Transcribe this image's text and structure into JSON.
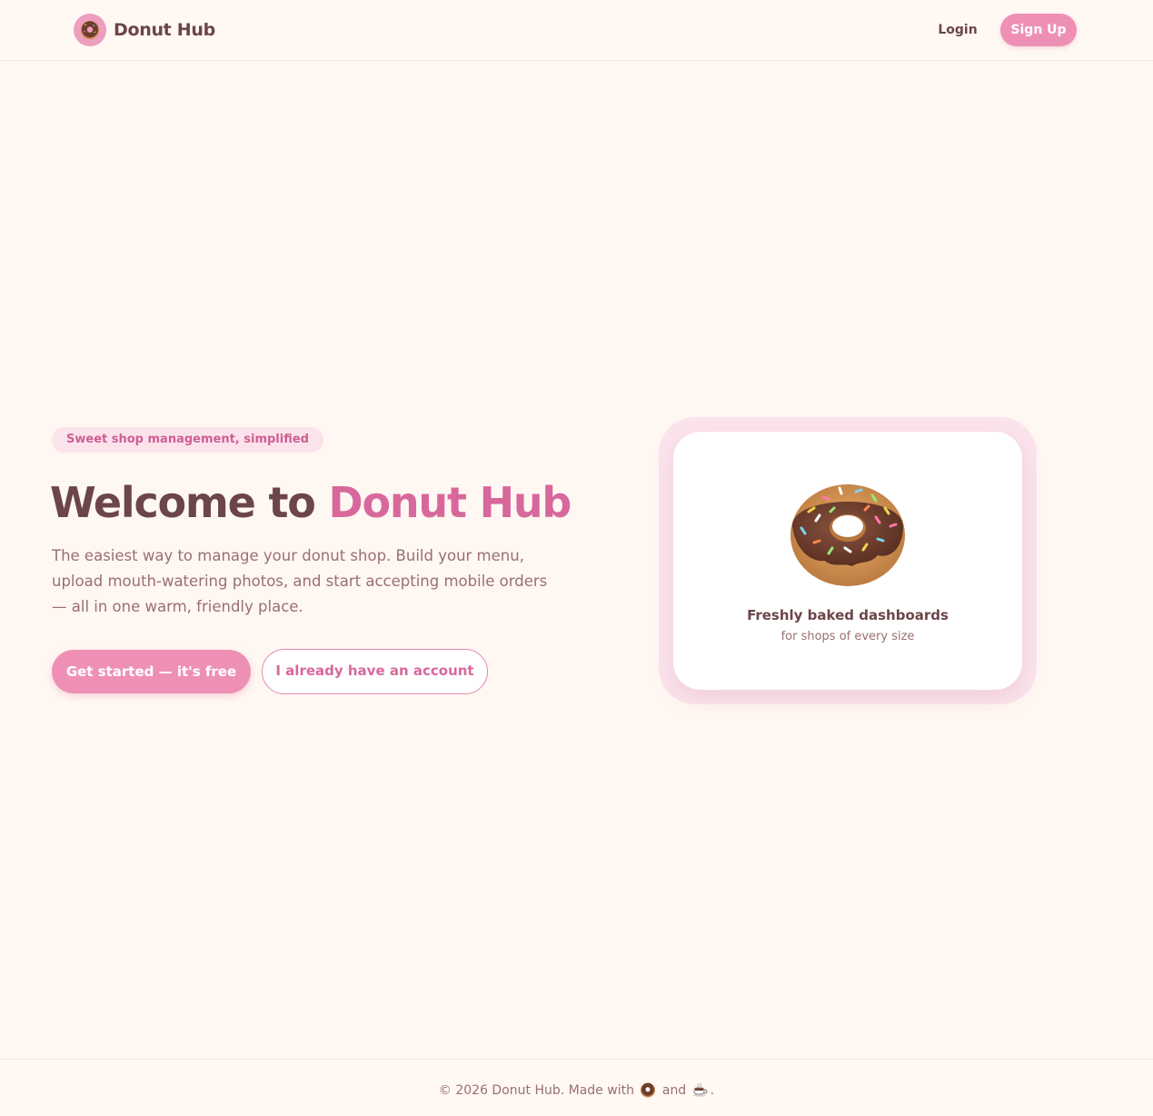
{
  "header": {
    "brand_name": "Donut Hub",
    "login_label": "Login",
    "signup_label": "Sign Up"
  },
  "hero": {
    "tagline": "Sweet shop management, simplified",
    "title_prefix": "Welcome to ",
    "title_accent": "Donut Hub",
    "description": "The easiest way to manage your donut shop. Build your menu, upload mouth-watering photos, and start accepting mobile orders — all in one warm, friendly place.",
    "primary_cta": "Get started — it's free",
    "secondary_cta": "I already have an account"
  },
  "card": {
    "icon": "donut-icon",
    "title": "Freshly baked dashboards",
    "subtitle": "for shops of every size"
  },
  "footer": {
    "text_before": "© 2026 Donut Hub. Made with ",
    "text_middle": " and ",
    "text_after": ".",
    "icons": [
      "donut-icon",
      "coffee-icon"
    ]
  },
  "colors": {
    "background": "#fff7f2",
    "accent_pink": "#ee90b5",
    "accent_text": "#d8689c",
    "heading": "#6b4549",
    "muted_text": "#9a6f73",
    "tag_bg": "#fbe3ec"
  }
}
